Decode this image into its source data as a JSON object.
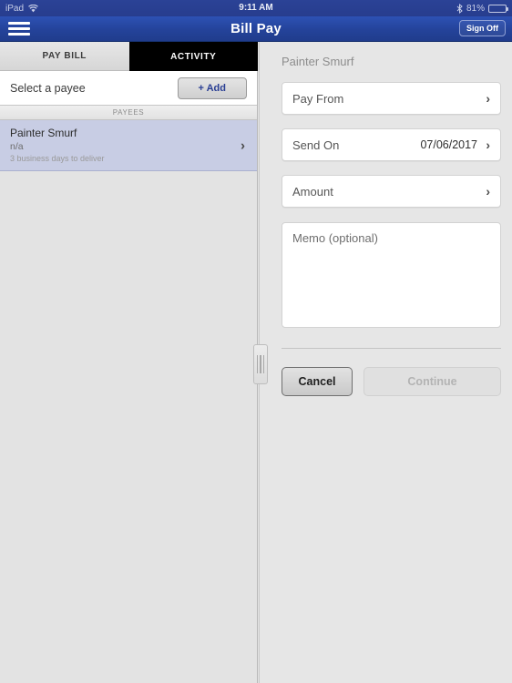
{
  "status_bar": {
    "device": "iPad",
    "wifi_icon": "wifi-icon",
    "time": "9:11 AM",
    "bluetooth_icon": "bluetooth-icon",
    "battery_percent": "81%",
    "battery_level": 81
  },
  "nav_bar": {
    "menu_icon": "hamburger-menu-icon",
    "title": "Bill Pay",
    "sign_off_label": "Sign Off"
  },
  "tabs": [
    {
      "label": "PAY BILL",
      "active": false
    },
    {
      "label": "ACTIVITY",
      "active": true
    }
  ],
  "left_panel": {
    "select_payee_label": "Select a payee",
    "add_button_label": "+ Add",
    "section_header": "PAYEES",
    "payees": [
      {
        "name": "Painter Smurf",
        "account": "n/a",
        "delivery": "3 business days to deliver",
        "chevron": "chevron-right-icon",
        "selected": true
      }
    ]
  },
  "right_panel": {
    "payee_title": "Painter Smurf",
    "fields": [
      {
        "label": "Pay From",
        "value": "",
        "chevron": "chevron-right-icon"
      },
      {
        "label": "Send On",
        "value": "07/06/2017",
        "chevron": "chevron-right-icon"
      },
      {
        "label": "Amount",
        "value": "",
        "chevron": "chevron-right-icon"
      }
    ],
    "memo_placeholder": "Memo (optional)",
    "memo_value": "",
    "buttons": {
      "cancel_label": "Cancel",
      "continue_label": "Continue",
      "continue_disabled": true
    }
  },
  "splitter": {
    "handle_icon": "drag-handle-icon"
  },
  "colors": {
    "nav_blue": "#24439a",
    "status_blue": "#273d8e",
    "accent_link": "#2a3f94",
    "selected_row": "#c8cde4",
    "pane_bg": "#e3e3e3",
    "active_tab_bg": "#000000"
  }
}
